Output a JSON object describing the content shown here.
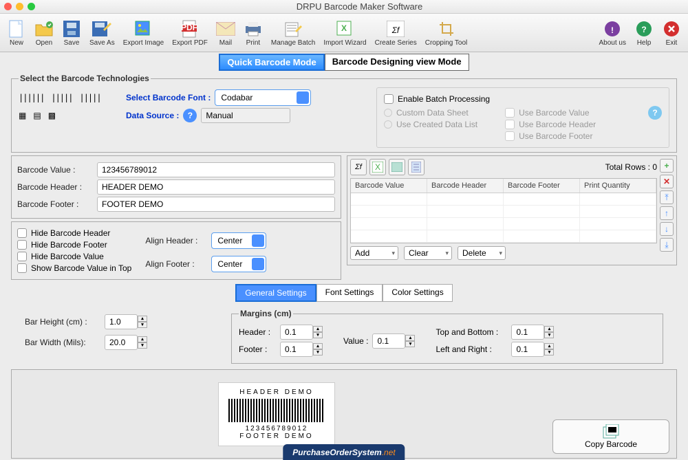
{
  "window": {
    "title": "DRPU Barcode Maker Software"
  },
  "toolbar": {
    "new": "New",
    "open": "Open",
    "save": "Save",
    "saveas": "Save As",
    "exportimg": "Export Image",
    "exportpdf": "Export PDF",
    "mail": "Mail",
    "print": "Print",
    "batch": "Manage Batch",
    "wizard": "Import Wizard",
    "series": "Create Series",
    "crop": "Cropping Tool",
    "about": "About us",
    "help": "Help",
    "exit": "Exit"
  },
  "modes": {
    "quick": "Quick Barcode Mode",
    "design": "Barcode Designing view Mode"
  },
  "tech": {
    "legend": "Select the Barcode Technologies",
    "fontlabel": "Select Barcode Font :",
    "font": "Codabar",
    "dslabel": "Data Source :",
    "ds": "Manual"
  },
  "batch": {
    "enable": "Enable Batch Processing",
    "custom": "Custom Data Sheet",
    "created": "Use Created Data List",
    "usevalue": "Use Barcode Value",
    "useheader": "Use Barcode Header",
    "usefooter": "Use Barcode Footer"
  },
  "values": {
    "bv_label": "Barcode Value :",
    "bv": "123456789012",
    "bh_label": "Barcode Header :",
    "bh": "HEADER DEMO",
    "bf_label": "Barcode Footer :",
    "bf": "FOOTER DEMO"
  },
  "opts": {
    "hideheader": "Hide Barcode Header",
    "hidefooter": "Hide Barcode Footer",
    "hidevalue": "Hide Barcode Value",
    "showtop": "Show Barcode Value in Top",
    "alignh": "Align Header :",
    "alignf": "Align Footer :",
    "center": "Center"
  },
  "gridpanel": {
    "total": "Total Rows : 0",
    "cols": {
      "c1": "Barcode Value",
      "c2": "Barcode Header",
      "c3": "Barcode Footer",
      "c4": "Print Quantity"
    },
    "add": "Add",
    "clear": "Clear",
    "delete": "Delete"
  },
  "tabs": {
    "general": "General Settings",
    "font": "Font Settings",
    "color": "Color Settings"
  },
  "dims": {
    "bh": "Bar Height (cm) :",
    "bhv": "1.0",
    "bw": "Bar Width (Mils):",
    "bwv": "20.0"
  },
  "margins": {
    "legend": "Margins (cm)",
    "header": "Header :",
    "footer": "Footer :",
    "value": "Value :",
    "tb": "Top and Bottom :",
    "lr": "Left and Right :",
    "v": "0.1"
  },
  "preview": {
    "header": "HEADER DEMO",
    "value": "123456789012",
    "footer": "FOOTER DEMO"
  },
  "copy": "Copy Barcode",
  "watermark": {
    "a": "PurchaseOrderSystem",
    "b": ".net"
  }
}
